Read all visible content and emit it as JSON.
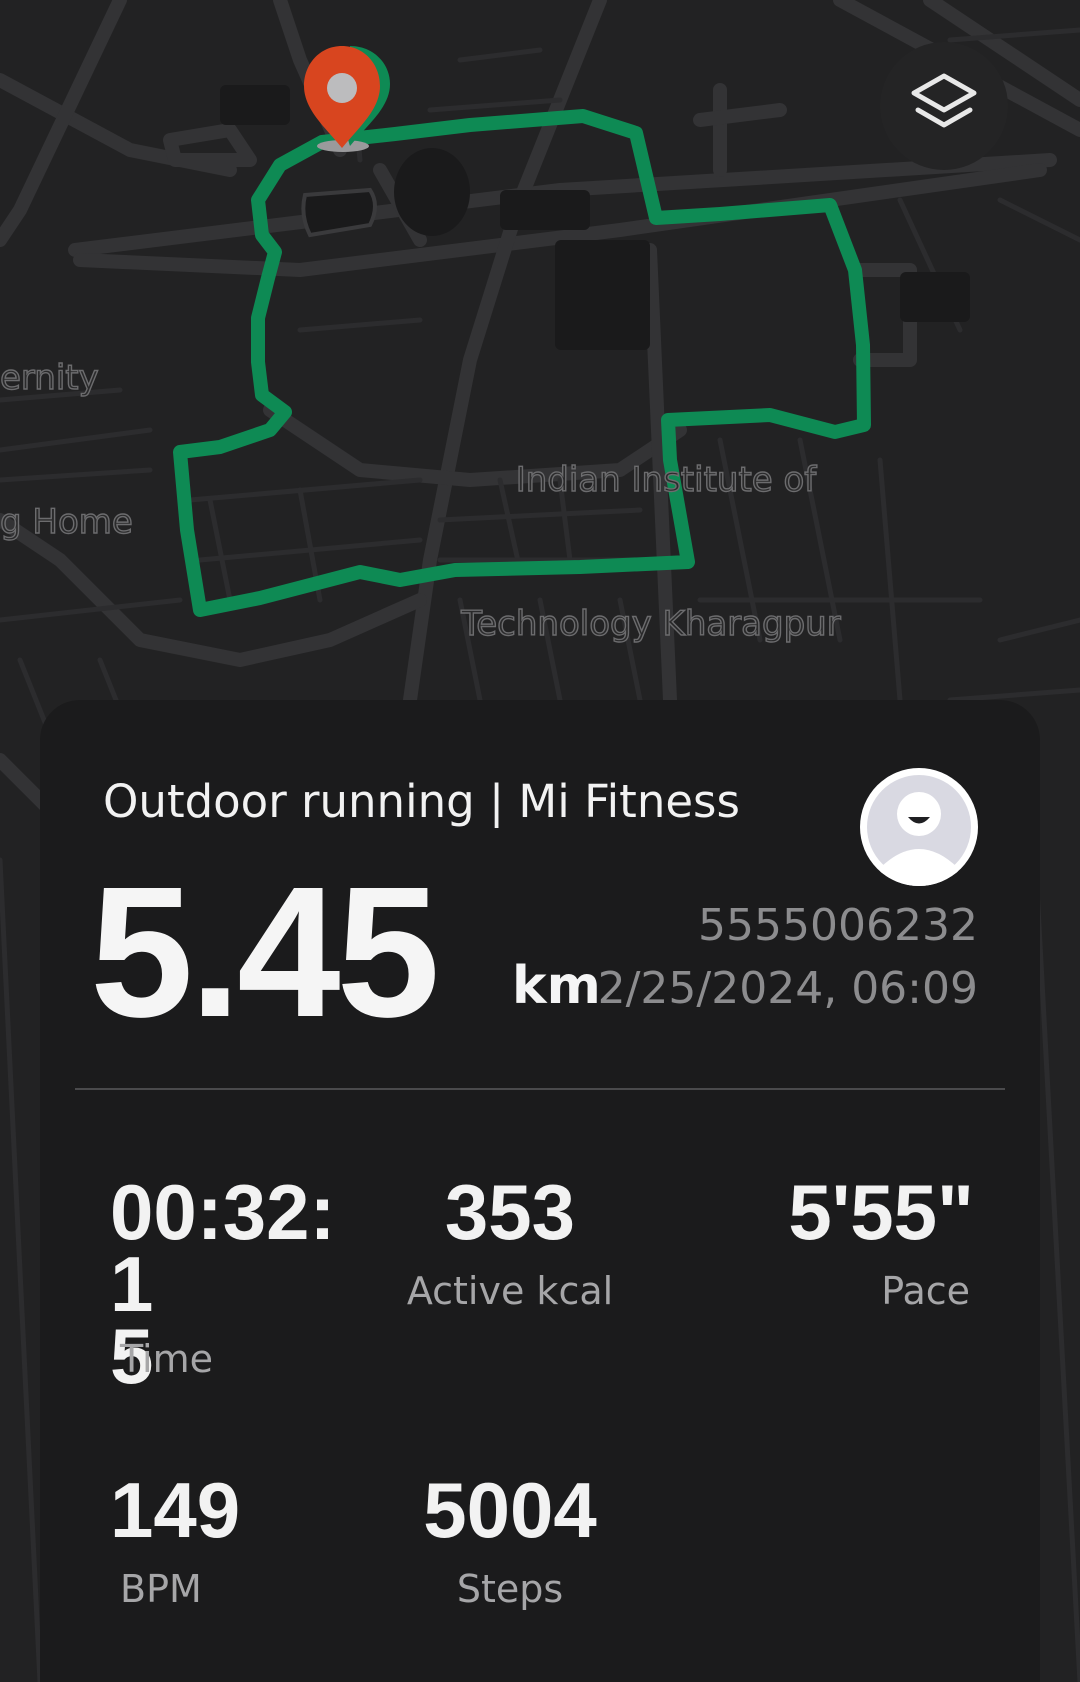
{
  "map": {
    "labels": {
      "fraternity_line1": "ernity",
      "fraternity_line2": "g Home",
      "campus_line1": "Indian Institute of",
      "campus_line2": "Technology Kharagpur"
    },
    "route_color": "#0e8a54",
    "marker_color": "#d8451f",
    "icons": {
      "start_marker": "location-pin-icon",
      "layers": "layers-icon"
    }
  },
  "activity": {
    "title": "Outdoor running | Mi Fitness",
    "distance": "5.45",
    "distance_unit": "km",
    "record_id": "5555006232",
    "date_time": "2/25/2024, 06:09",
    "avatar_icon": "user-avatar-icon"
  },
  "stats": {
    "time": {
      "value": "00:32:1\n5",
      "label": "Time"
    },
    "calories": {
      "value": "353",
      "label": "Active kcal"
    },
    "pace": {
      "value": "5'55\"",
      "label": "Pace"
    },
    "heart_rate": {
      "value": "149",
      "label": "BPM"
    },
    "steps": {
      "value": "5004",
      "label": "Steps"
    }
  }
}
